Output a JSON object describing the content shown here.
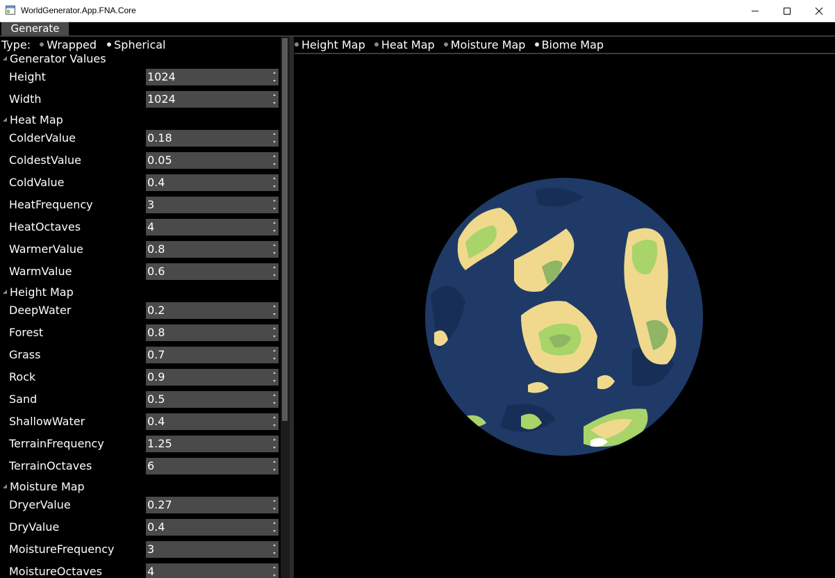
{
  "window": {
    "title": "WorldGenerator.App.FNA.Core"
  },
  "menu": {
    "generate_label": "Generate"
  },
  "type_selector": {
    "label": "Type:",
    "options": [
      "Wrapped",
      "Spherical"
    ],
    "selected": "Spherical"
  },
  "sections": {
    "generator": {
      "title": "Generator Values",
      "fields": [
        {
          "label": "Height",
          "value": "1024"
        },
        {
          "label": "Width",
          "value": "1024"
        }
      ]
    },
    "heat": {
      "title": "Heat Map",
      "fields": [
        {
          "label": "ColderValue",
          "value": "0.18"
        },
        {
          "label": "ColdestValue",
          "value": "0.05"
        },
        {
          "label": "ColdValue",
          "value": "0.4"
        },
        {
          "label": "HeatFrequency",
          "value": "3"
        },
        {
          "label": "HeatOctaves",
          "value": "4"
        },
        {
          "label": "WarmerValue",
          "value": "0.8"
        },
        {
          "label": "WarmValue",
          "value": "0.6"
        }
      ]
    },
    "height": {
      "title": "Height Map",
      "fields": [
        {
          "label": "DeepWater",
          "value": "0.2"
        },
        {
          "label": "Forest",
          "value": "0.8"
        },
        {
          "label": "Grass",
          "value": "0.7"
        },
        {
          "label": "Rock",
          "value": "0.9"
        },
        {
          "label": "Sand",
          "value": "0.5"
        },
        {
          "label": "ShallowWater",
          "value": "0.4"
        },
        {
          "label": "TerrainFrequency",
          "value": "1.25"
        },
        {
          "label": "TerrainOctaves",
          "value": "6"
        }
      ]
    },
    "moisture": {
      "title": "Moisture Map",
      "fields": [
        {
          "label": "DryerValue",
          "value": "0.27"
        },
        {
          "label": "DryValue",
          "value": "0.4"
        },
        {
          "label": "MoistureFrequency",
          "value": "3"
        },
        {
          "label": "MoistureOctaves",
          "value": "4"
        }
      ]
    }
  },
  "view_tabs": {
    "items": [
      "Height Map",
      "Heat Map",
      "Moisture Map",
      "Biome Map"
    ],
    "selected": "Biome Map"
  },
  "colors": {
    "ocean": "#1f3a66",
    "deep_ocean": "#172f57",
    "sand": "#f0d98c",
    "grass": "#a8d46a",
    "forest": "#8fb565"
  }
}
